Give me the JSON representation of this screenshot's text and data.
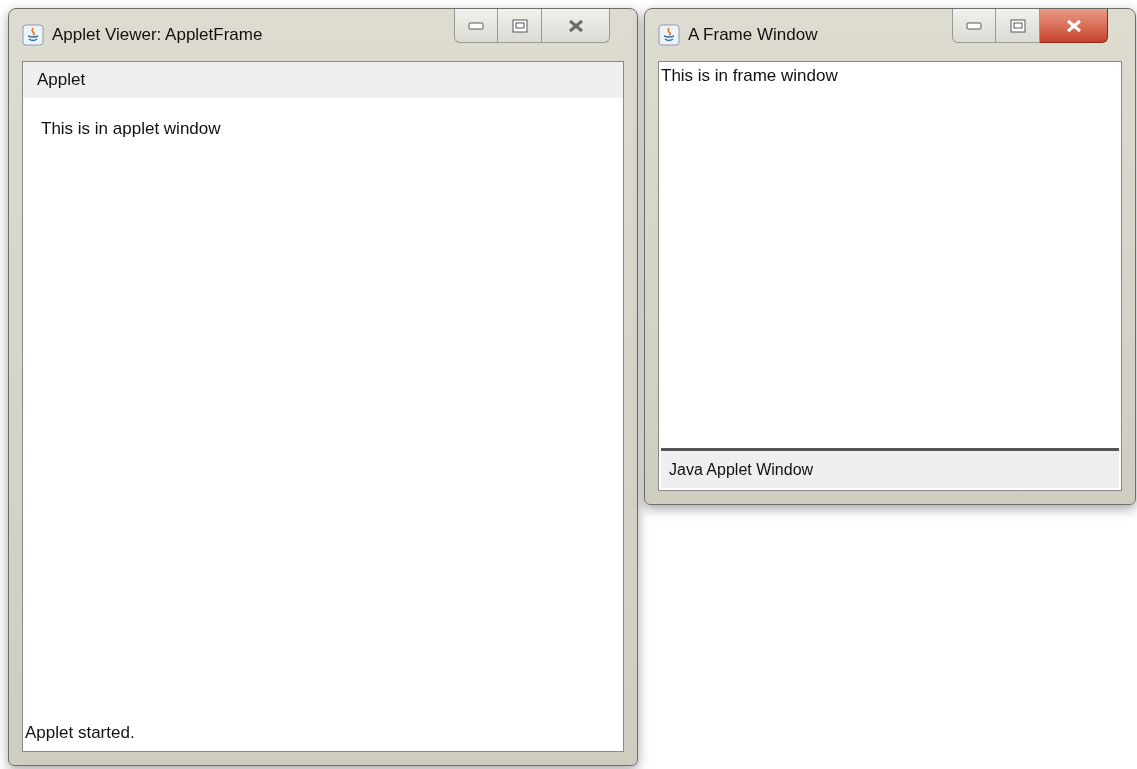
{
  "windows": [
    {
      "title": "Applet Viewer: AppletFrame",
      "active": false,
      "menu": [
        "Applet"
      ],
      "content": "This is in applet window",
      "status": "Applet started."
    },
    {
      "title": "A Frame Window",
      "active": true,
      "content": "This is in frame window",
      "status": "Java Applet Window"
    }
  ]
}
